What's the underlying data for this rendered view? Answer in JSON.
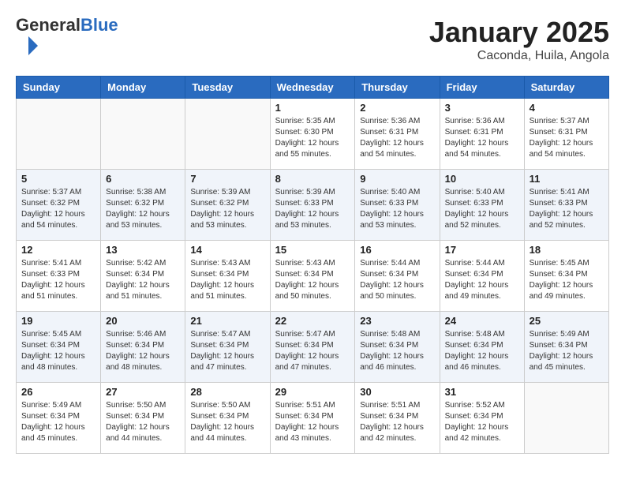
{
  "header": {
    "logo_general": "General",
    "logo_blue": "Blue",
    "month": "January 2025",
    "location": "Caconda, Huila, Angola"
  },
  "days_of_week": [
    "Sunday",
    "Monday",
    "Tuesday",
    "Wednesday",
    "Thursday",
    "Friday",
    "Saturday"
  ],
  "weeks": [
    [
      {
        "num": "",
        "info": ""
      },
      {
        "num": "",
        "info": ""
      },
      {
        "num": "",
        "info": ""
      },
      {
        "num": "1",
        "info": "Sunrise: 5:35 AM\nSunset: 6:30 PM\nDaylight: 12 hours\nand 55 minutes."
      },
      {
        "num": "2",
        "info": "Sunrise: 5:36 AM\nSunset: 6:31 PM\nDaylight: 12 hours\nand 54 minutes."
      },
      {
        "num": "3",
        "info": "Sunrise: 5:36 AM\nSunset: 6:31 PM\nDaylight: 12 hours\nand 54 minutes."
      },
      {
        "num": "4",
        "info": "Sunrise: 5:37 AM\nSunset: 6:31 PM\nDaylight: 12 hours\nand 54 minutes."
      }
    ],
    [
      {
        "num": "5",
        "info": "Sunrise: 5:37 AM\nSunset: 6:32 PM\nDaylight: 12 hours\nand 54 minutes."
      },
      {
        "num": "6",
        "info": "Sunrise: 5:38 AM\nSunset: 6:32 PM\nDaylight: 12 hours\nand 53 minutes."
      },
      {
        "num": "7",
        "info": "Sunrise: 5:39 AM\nSunset: 6:32 PM\nDaylight: 12 hours\nand 53 minutes."
      },
      {
        "num": "8",
        "info": "Sunrise: 5:39 AM\nSunset: 6:33 PM\nDaylight: 12 hours\nand 53 minutes."
      },
      {
        "num": "9",
        "info": "Sunrise: 5:40 AM\nSunset: 6:33 PM\nDaylight: 12 hours\nand 53 minutes."
      },
      {
        "num": "10",
        "info": "Sunrise: 5:40 AM\nSunset: 6:33 PM\nDaylight: 12 hours\nand 52 minutes."
      },
      {
        "num": "11",
        "info": "Sunrise: 5:41 AM\nSunset: 6:33 PM\nDaylight: 12 hours\nand 52 minutes."
      }
    ],
    [
      {
        "num": "12",
        "info": "Sunrise: 5:41 AM\nSunset: 6:33 PM\nDaylight: 12 hours\nand 51 minutes."
      },
      {
        "num": "13",
        "info": "Sunrise: 5:42 AM\nSunset: 6:34 PM\nDaylight: 12 hours\nand 51 minutes."
      },
      {
        "num": "14",
        "info": "Sunrise: 5:43 AM\nSunset: 6:34 PM\nDaylight: 12 hours\nand 51 minutes."
      },
      {
        "num": "15",
        "info": "Sunrise: 5:43 AM\nSunset: 6:34 PM\nDaylight: 12 hours\nand 50 minutes."
      },
      {
        "num": "16",
        "info": "Sunrise: 5:44 AM\nSunset: 6:34 PM\nDaylight: 12 hours\nand 50 minutes."
      },
      {
        "num": "17",
        "info": "Sunrise: 5:44 AM\nSunset: 6:34 PM\nDaylight: 12 hours\nand 49 minutes."
      },
      {
        "num": "18",
        "info": "Sunrise: 5:45 AM\nSunset: 6:34 PM\nDaylight: 12 hours\nand 49 minutes."
      }
    ],
    [
      {
        "num": "19",
        "info": "Sunrise: 5:45 AM\nSunset: 6:34 PM\nDaylight: 12 hours\nand 48 minutes."
      },
      {
        "num": "20",
        "info": "Sunrise: 5:46 AM\nSunset: 6:34 PM\nDaylight: 12 hours\nand 48 minutes."
      },
      {
        "num": "21",
        "info": "Sunrise: 5:47 AM\nSunset: 6:34 PM\nDaylight: 12 hours\nand 47 minutes."
      },
      {
        "num": "22",
        "info": "Sunrise: 5:47 AM\nSunset: 6:34 PM\nDaylight: 12 hours\nand 47 minutes."
      },
      {
        "num": "23",
        "info": "Sunrise: 5:48 AM\nSunset: 6:34 PM\nDaylight: 12 hours\nand 46 minutes."
      },
      {
        "num": "24",
        "info": "Sunrise: 5:48 AM\nSunset: 6:34 PM\nDaylight: 12 hours\nand 46 minutes."
      },
      {
        "num": "25",
        "info": "Sunrise: 5:49 AM\nSunset: 6:34 PM\nDaylight: 12 hours\nand 45 minutes."
      }
    ],
    [
      {
        "num": "26",
        "info": "Sunrise: 5:49 AM\nSunset: 6:34 PM\nDaylight: 12 hours\nand 45 minutes."
      },
      {
        "num": "27",
        "info": "Sunrise: 5:50 AM\nSunset: 6:34 PM\nDaylight: 12 hours\nand 44 minutes."
      },
      {
        "num": "28",
        "info": "Sunrise: 5:50 AM\nSunset: 6:34 PM\nDaylight: 12 hours\nand 44 minutes."
      },
      {
        "num": "29",
        "info": "Sunrise: 5:51 AM\nSunset: 6:34 PM\nDaylight: 12 hours\nand 43 minutes."
      },
      {
        "num": "30",
        "info": "Sunrise: 5:51 AM\nSunset: 6:34 PM\nDaylight: 12 hours\nand 42 minutes."
      },
      {
        "num": "31",
        "info": "Sunrise: 5:52 AM\nSunset: 6:34 PM\nDaylight: 12 hours\nand 42 minutes."
      },
      {
        "num": "",
        "info": ""
      }
    ]
  ]
}
